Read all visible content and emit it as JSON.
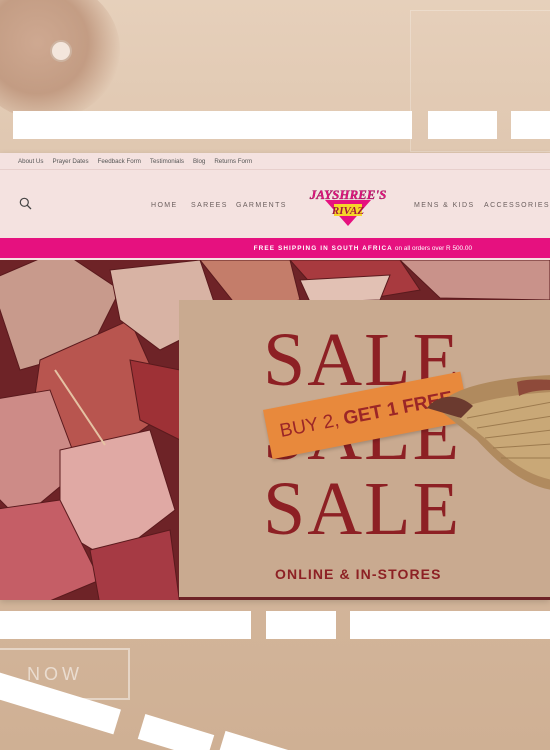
{
  "utility_links": [
    "About Us",
    "Prayer Dates",
    "Feedback Form",
    "Testimonials",
    "Blog",
    "Returns Form"
  ],
  "nav": {
    "left": [
      "HOME",
      "SAREES",
      "GARMENTS"
    ],
    "right": [
      "MENS & KIDS",
      "ACCESSORIES"
    ],
    "logo_top": "JAYSHREE'S",
    "logo_bottom": "RIVAZ"
  },
  "promo": {
    "strong": "FREE SHIPPING IN SOUTH AFRICA",
    "rest": "on all orders over R 500.00"
  },
  "hero": {
    "sale": "SALE",
    "offer_light": "BUY 2,",
    "offer_bold": "GET 1 FREE",
    "cta": "ONLINE & IN-STORES"
  },
  "backdrop": {
    "now_text": "NOW"
  },
  "colors": {
    "promo_bar": "#e6117f",
    "sale_text": "#8d2024",
    "tag": "#e8893c",
    "header_bg": "#f4e2e0"
  }
}
